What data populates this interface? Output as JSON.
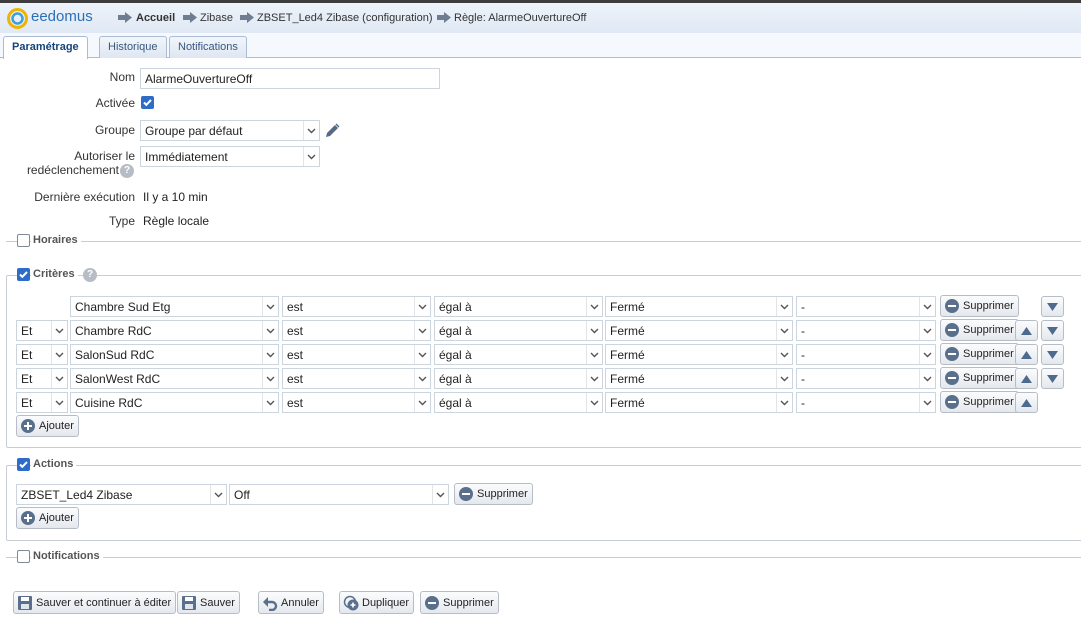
{
  "app": {
    "logo_text": "eedomus"
  },
  "breadcrumb": [
    "Accueil",
    "Zibase",
    "ZBSET_Led4 Zibase (configuration)",
    "Règle: AlarmeOuvertureOff"
  ],
  "tabs": [
    "Paramétrage",
    "Historique",
    "Notifications"
  ],
  "form": {
    "nom_label": "Nom",
    "nom_value": "AlarmeOuvertureOff",
    "activee_label": "Activée",
    "activee_checked": true,
    "groupe_label": "Groupe",
    "groupe_value": "Groupe par défaut",
    "autoriser_label_1": "Autoriser le",
    "autoriser_label_2": "redéclenchement",
    "autoriser_value": "Immédiatement",
    "derniere_label": "Dernière exécution",
    "derniere_value": "Il y a 10 min",
    "type_label": "Type",
    "type_value": "Règle locale"
  },
  "sections": {
    "horaires": {
      "label": "Horaires",
      "checked": false
    },
    "criteres": {
      "label": "Critères",
      "checked": true
    },
    "actions": {
      "label": "Actions",
      "checked": true
    },
    "notifications": {
      "label": "Notifications",
      "checked": false
    }
  },
  "criteria": [
    {
      "conj": "",
      "device": "Chambre Sud Etg",
      "op": "est",
      "cmp": "égal à",
      "value": "Fermé",
      "extra": "-"
    },
    {
      "conj": "Et",
      "device": "Chambre RdC",
      "op": "est",
      "cmp": "égal à",
      "value": "Fermé",
      "extra": "-"
    },
    {
      "conj": "Et",
      "device": "SalonSud RdC",
      "op": "est",
      "cmp": "égal à",
      "value": "Fermé",
      "extra": "-"
    },
    {
      "conj": "Et",
      "device": "SalonWest RdC",
      "op": "est",
      "cmp": "égal à",
      "value": "Fermé",
      "extra": "-"
    },
    {
      "conj": "Et",
      "device": "Cuisine RdC",
      "op": "est",
      "cmp": "égal à",
      "value": "Fermé",
      "extra": "-"
    }
  ],
  "criteria_delete_label": "Supprimer",
  "add_label": "Ajouter",
  "actions": [
    {
      "device": "ZBSET_Led4 Zibase",
      "value": "Off"
    }
  ],
  "action_delete_label": "Supprimer",
  "footer": {
    "save_continue": "Sauver et continuer à éditer",
    "save": "Sauver",
    "cancel": "Annuler",
    "duplicate": "Dupliquer",
    "delete": "Supprimer"
  },
  "colors": {
    "accent": "#2e6cc7",
    "tab_text": "#15447b"
  }
}
